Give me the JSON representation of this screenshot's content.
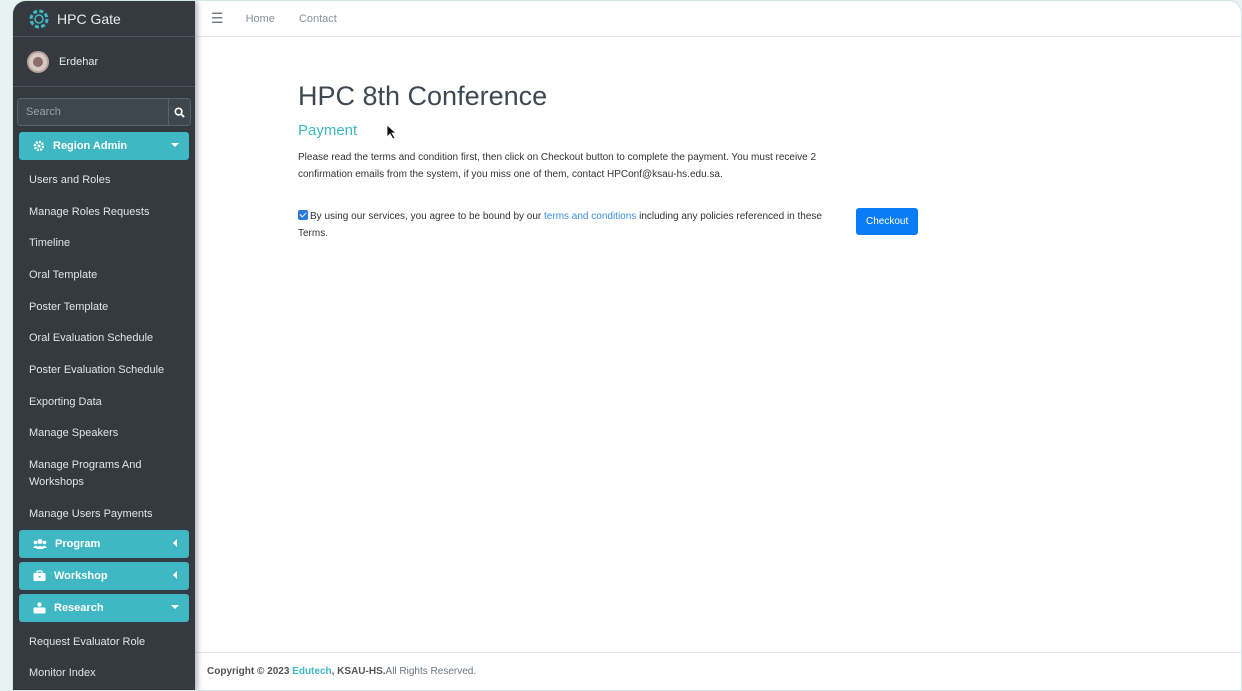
{
  "app": {
    "brand": "HPC Gate"
  },
  "user": {
    "name": "Erdehar"
  },
  "search": {
    "placeholder": "Search"
  },
  "sidebar": {
    "region_admin": {
      "label": "Region Admin",
      "items": [
        "Users and Roles",
        "Manage Roles Requests",
        "Timeline",
        "Oral Template",
        "Poster Template",
        "Oral Evaluation Schedule",
        "Poster Evaluation Schedule",
        "Exporting Data",
        "Manage Speakers",
        "Manage Programs And Workshops",
        "Manage Users Payments"
      ]
    },
    "program": {
      "label": "Program"
    },
    "workshop": {
      "label": "Workshop"
    },
    "research": {
      "label": "Research",
      "items": [
        "Request Evaluator Role",
        "Monitor Index"
      ]
    }
  },
  "topnav": {
    "home": "Home",
    "contact": "Contact"
  },
  "main": {
    "title": "HPC 8th Conference",
    "subtitle": "Payment",
    "instructions": "Please read the terms and condition first, then click on Checkout button to complete the payment. You must receive 2 confirmation emails from the system, if you miss one of them, contact HPConf@ksau-hs.edu.sa.",
    "agree_before": "By using our services, you agree to be bound by our ",
    "agree_link": "terms and conditions",
    "agree_after": " including any policies referenced in these Terms.",
    "agree_checked": true,
    "checkout_label": "Checkout"
  },
  "footer": {
    "prefix": "Copyright © 2023 ",
    "company": "Edutech",
    "org": ", KSAU-HS.",
    "suffix": "All Rights Reserved."
  },
  "colors": {
    "sidebar": "#343a40",
    "accent": "#3fb8c4",
    "button": "#0a7cf5"
  }
}
